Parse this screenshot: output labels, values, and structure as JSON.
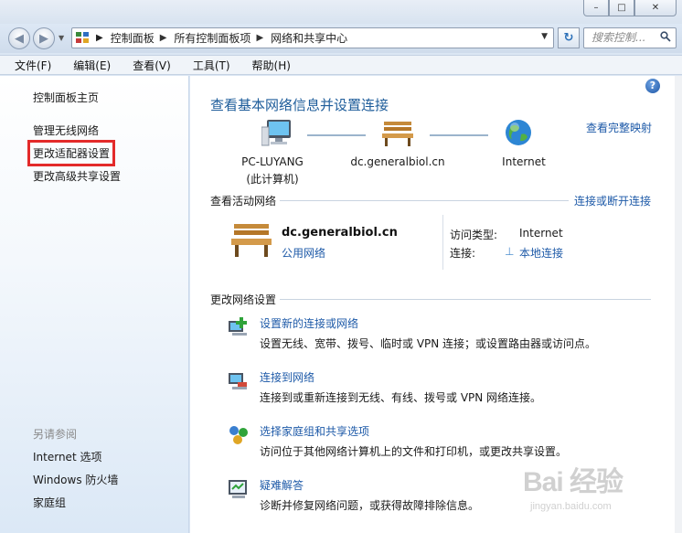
{
  "window": {
    "min_glyph": "–",
    "max_glyph": "□",
    "close_glyph": "✕"
  },
  "address": {
    "breadcrumbs": [
      "控制面板",
      "所有控制面板项",
      "网络和共享中心"
    ],
    "search_placeholder": "搜索控制..."
  },
  "menu": [
    "文件(F)",
    "编辑(E)",
    "查看(V)",
    "工具(T)",
    "帮助(H)"
  ],
  "sidebar": {
    "home": "控制面板主页",
    "links": [
      "管理无线网络",
      "更改适配器设置",
      "更改高级共享设置"
    ],
    "see_also_title": "另请参阅",
    "see_also": [
      "Internet 选项",
      "Windows 防火墙",
      "家庭组"
    ]
  },
  "main": {
    "title": "查看基本网络信息并设置连接",
    "full_map": "查看完整映射",
    "map": {
      "computer_name": "PC-LUYANG",
      "computer_sub": "(此计算机)",
      "network_name": "dc.generalbiol.cn",
      "internet": "Internet"
    },
    "active": {
      "heading": "查看活动网络",
      "connect_link": "连接或断开连接",
      "network_name": "dc.generalbiol.cn",
      "network_type": "公用网络",
      "access_label": "访问类型:",
      "access_value": "Internet",
      "conn_label": "连接:",
      "conn_value": "本地连接"
    },
    "change": {
      "heading": "更改网络设置",
      "tasks": [
        {
          "title": "设置新的连接或网络",
          "desc": "设置无线、宽带、拨号、临时或 VPN 连接；或设置路由器或访问点。",
          "icon": "new-connection-icon"
        },
        {
          "title": "连接到网络",
          "desc": "连接到或重新连接到无线、有线、拨号或 VPN 网络连接。",
          "icon": "connect-network-icon"
        },
        {
          "title": "选择家庭组和共享选项",
          "desc": "访问位于其他网络计算机上的文件和打印机，或更改共享设置。",
          "icon": "homegroup-icon"
        },
        {
          "title": "疑难解答",
          "desc": "诊断并修复网络问题，或获得故障排除信息。",
          "icon": "troubleshoot-icon"
        }
      ]
    }
  },
  "watermark": {
    "logo": "Bai 经验",
    "url": "jingyan.baidu.com"
  },
  "colors": {
    "link": "#1e5aa8",
    "title": "#1d5c9a",
    "highlight_box": "#e32a2a"
  }
}
